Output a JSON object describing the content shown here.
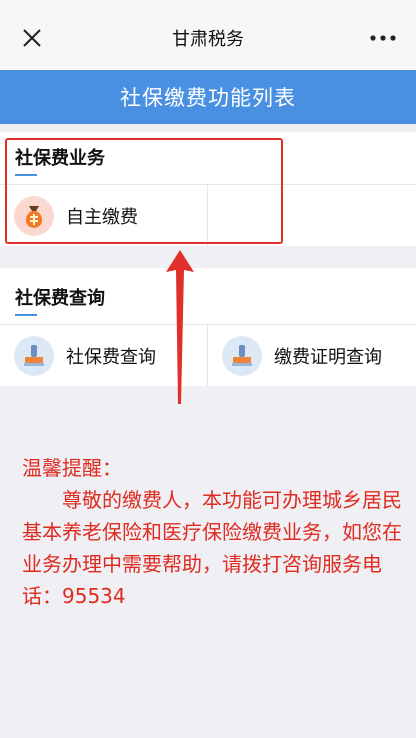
{
  "nav": {
    "title": "甘肃税务",
    "close_icon": "close-icon",
    "more_icon": "more-dots-icon"
  },
  "header": {
    "title": "社保缴费功能列表"
  },
  "sections": [
    {
      "title": "社保费业务",
      "items": [
        {
          "label": "自主缴费",
          "icon": "money-bag-icon"
        }
      ]
    },
    {
      "title": "社保费查询",
      "items": [
        {
          "label": "社保费查询",
          "icon": "stamp-icon"
        },
        {
          "label": "缴费证明查询",
          "icon": "stamp-icon"
        }
      ]
    }
  ],
  "notice": {
    "heading": "温馨提醒：",
    "body": "尊敬的缴费人，本功能可办理城乡居民基本养老保险和医疗保险缴费业务，如您在业务办理中需要帮助，请拨打咨询服务电话：95534"
  },
  "colors": {
    "accent": "#4a90e2",
    "annotation_red": "#e0302a",
    "notice_red": "#e02b20"
  }
}
